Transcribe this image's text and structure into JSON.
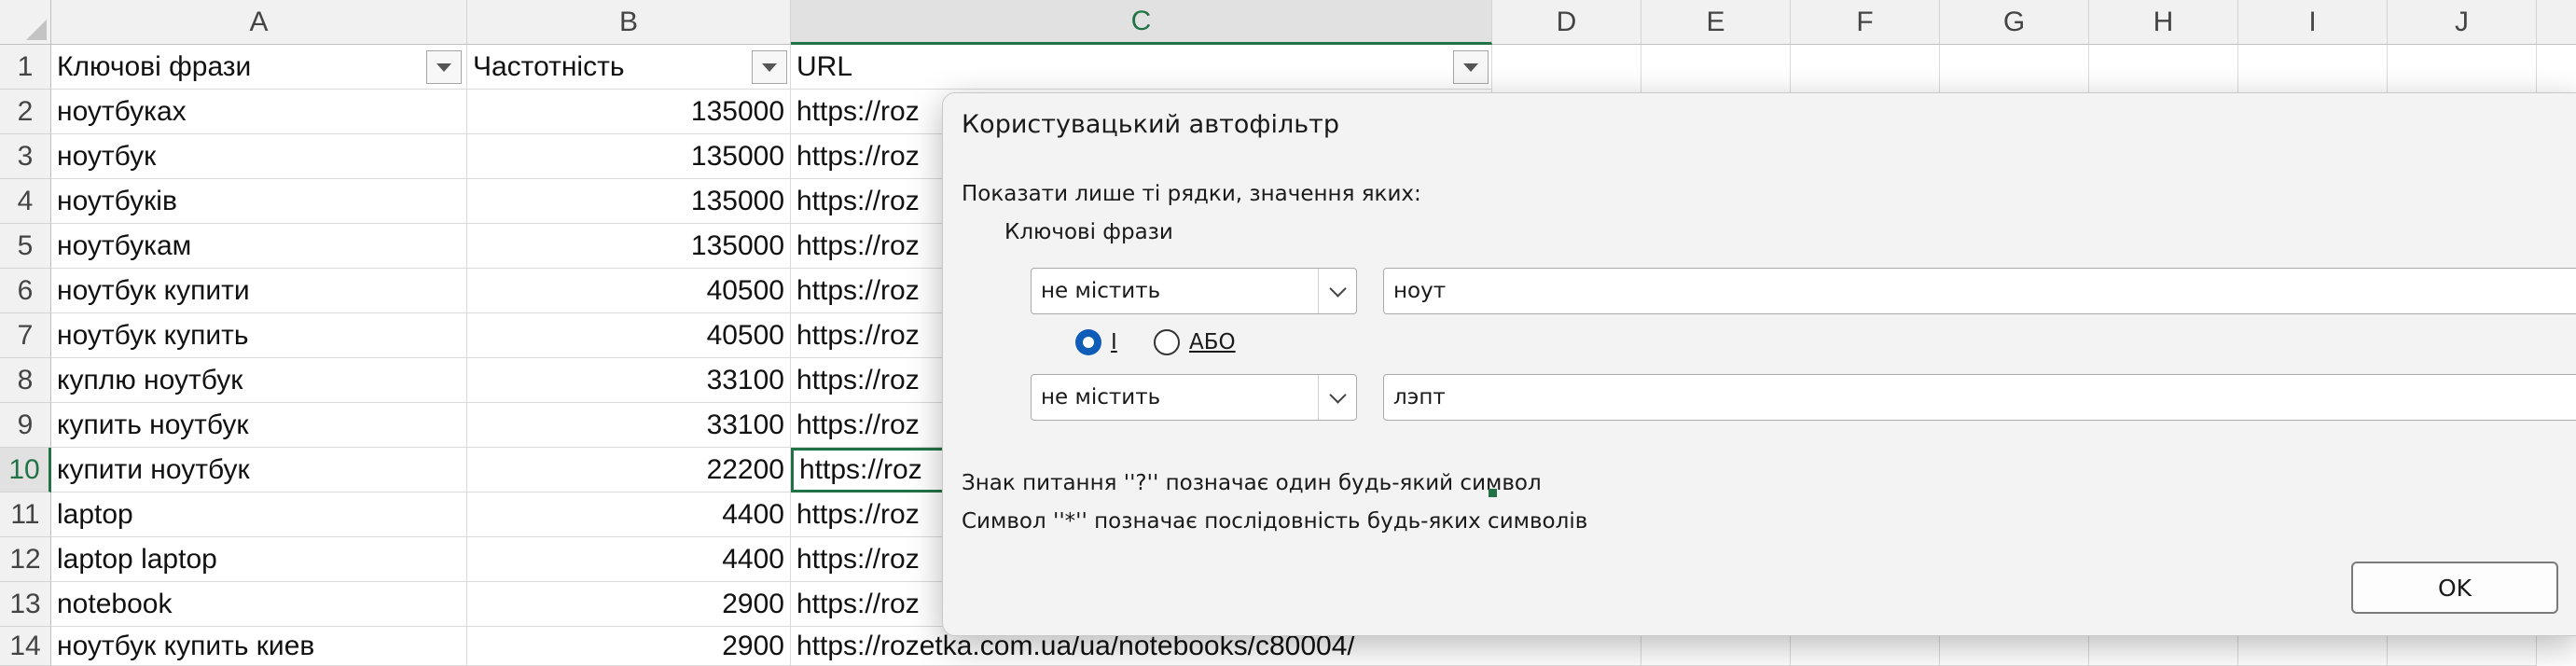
{
  "columns": [
    "A",
    "B",
    "C",
    "D",
    "E",
    "F",
    "G",
    "H",
    "I",
    "J"
  ],
  "row_numbers": [
    "1",
    "2",
    "3",
    "4",
    "5",
    "6",
    "7",
    "8",
    "9",
    "10",
    "11",
    "12",
    "13",
    "14"
  ],
  "headers": {
    "a": "Ключові фрази",
    "b": "Частотність",
    "c": "URL"
  },
  "rows": [
    {
      "phrase": "ноутбуках",
      "freq": "135000",
      "url": "https://roz"
    },
    {
      "phrase": "ноутбук",
      "freq": "135000",
      "url": "https://roz"
    },
    {
      "phrase": "ноутбуків",
      "freq": "135000",
      "url": "https://roz"
    },
    {
      "phrase": "ноутбукам",
      "freq": "135000",
      "url": "https://roz"
    },
    {
      "phrase": "ноутбук купити",
      "freq": "40500",
      "url": "https://roz"
    },
    {
      "phrase": "ноутбук купить",
      "freq": "40500",
      "url": "https://roz"
    },
    {
      "phrase": "куплю ноутбук",
      "freq": "33100",
      "url": "https://roz"
    },
    {
      "phrase": "купить ноутбук",
      "freq": "33100",
      "url": "https://roz"
    },
    {
      "phrase": "купити ноутбук",
      "freq": "22200",
      "url": "https://roz"
    },
    {
      "phrase": "laptop",
      "freq": "4400",
      "url": "https://roz"
    },
    {
      "phrase": "laptop laptop",
      "freq": "4400",
      "url": "https://roz"
    },
    {
      "phrase": "notebook",
      "freq": "2900",
      "url": "https://roz"
    },
    {
      "phrase": "ноутбук купить киев",
      "freq": "2900",
      "url": "https://rozetka.com.ua/ua/notebooks/c80004/"
    }
  ],
  "dialog": {
    "title": "Користувацький автофільтр",
    "instruction": "Показати лише ті рядки, значення яких:",
    "field_label": "Ключові фрази",
    "condition1": {
      "operator": "не містить",
      "value": "ноут"
    },
    "logic": {
      "and_label": "І",
      "or_label": "АБО",
      "selected": "and"
    },
    "condition2": {
      "operator": "не містить",
      "value": "лэпт"
    },
    "hint1": "Знак питання ''?'' позначає один будь-який символ",
    "hint2": "Символ ''*'' позначає послідовність будь-яких символів",
    "ok_label": "OK"
  },
  "colors": {
    "accent_green": "#217346",
    "radio_blue": "#0f5db8"
  }
}
